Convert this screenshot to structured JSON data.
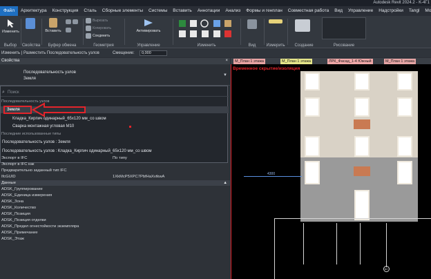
{
  "window": {
    "app_title": "Autodesk Revit 2024.2 - K-4Г1"
  },
  "menu": {
    "file": "Файл",
    "items": [
      "Архитектура",
      "Конструкция",
      "Сталь",
      "Сборные элементы",
      "Системы",
      "Вставить",
      "Аннотации",
      "Анализ",
      "Формы и генплан",
      "Совместная работа",
      "Вид",
      "Управление",
      "Надстройки",
      "Tangl",
      "ModPlus"
    ]
  },
  "ribbon": {
    "modify_btn": "Изменить",
    "paste_btn": "Вставить",
    "copy_mini": "Вырезать",
    "cut_mini": "Копировать",
    "join_mini": "Соединить",
    "activate_btn": "Активировать",
    "groups": {
      "select": "Выбор",
      "properties": "Свойства",
      "clipboard": "Буфер обмена",
      "geometry": "Геометрия",
      "control": "Управление",
      "modify": "Изменить",
      "view": "Вид",
      "measure": "Измерить",
      "create": "Создание",
      "draw": "Рисование"
    }
  },
  "options_bar": {
    "breadcrumb": "Изменить | Разместить Последовательность узлов",
    "offset_label": "Смещение:",
    "offset_value": "0,000"
  },
  "properties": {
    "title": "Свойства",
    "close": "×",
    "type_line1": "Последовательность узлов",
    "type_line2": "Земля",
    "dropdown": {
      "search_placeholder": "Поиск",
      "category": "Последовательность узлов",
      "selected": "Земля",
      "options": [
        "Кладка_Кирпич одинарный_65x120 мм_со швом",
        "Сварка монтажная угловая М10"
      ],
      "recent_header": "Последние использованные типы",
      "recent": [
        "Последовательность узлов : Земля",
        "Последовательность узлов : Кладка_Кирпич одинарный_65x120 мм_со швом"
      ]
    },
    "rows": [
      {
        "label": "Экспорт в IFC",
        "value": "По типу"
      },
      {
        "label": "Экспорт в IFC как",
        "value": ""
      },
      {
        "label": "Предварительно заданный тип IFC",
        "value": ""
      },
      {
        "label": "IfcGUID",
        "value": "1XkMcP5XPC7PbfHaXvtkwA"
      }
    ],
    "section_data": "Данные",
    "data_rows": [
      "ADSK_Группирование",
      "ADSK_Единица измерения",
      "ADSK_Зона",
      "ADSK_Количество",
      "ADSK_Позиция",
      "ADSK_Позиция отделки",
      "ADSK_Предел огнестойкости экземпляра",
      "ADSK_Примечание",
      "ADSK_Этаж"
    ]
  },
  "view_tabs": [
    {
      "label": "М_План 1 этажа",
      "color": "#e8a3a3"
    },
    {
      "label": "М_План 1 этажа",
      "color": "#e6e68a"
    },
    {
      "label": "ЛРК_Фасад_1-4 Южный",
      "color": "#f0a8a8"
    },
    {
      "label": "М_План 1 этажа",
      "color": "#e6a5a5"
    }
  ],
  "canvas": {
    "temp_label": "Временное скрытие/изоляция",
    "dimension": "4300",
    "grid_label": "6С"
  },
  "colors": {
    "accent": "#1e6fc1",
    "highlight": "#e4242b"
  }
}
